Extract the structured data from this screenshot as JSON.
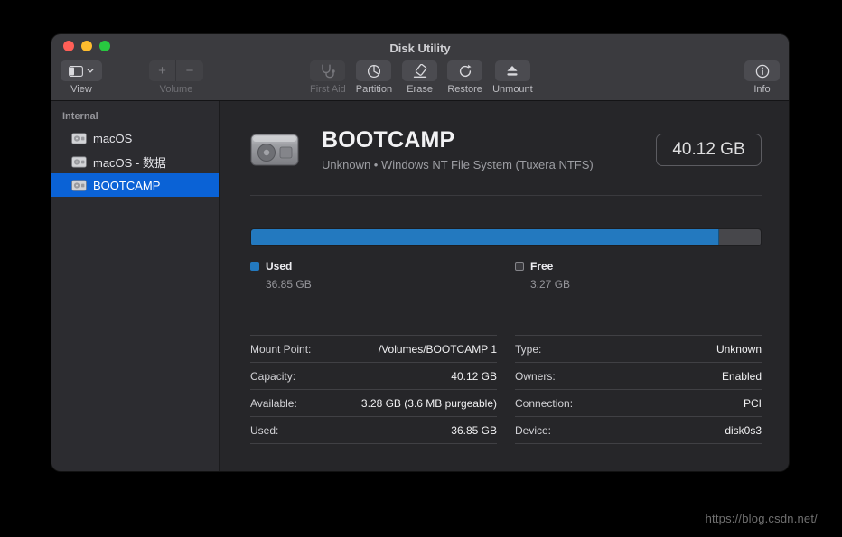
{
  "window": {
    "title": "Disk Utility"
  },
  "toolbar": {
    "view_label": "View",
    "volume_label": "Volume",
    "volume_add_label": "+",
    "volume_remove_label": "−",
    "buttons": [
      {
        "id": "first-aid",
        "label": "First Aid",
        "icon": "first-aid-icon",
        "enabled": false
      },
      {
        "id": "partition",
        "label": "Partition",
        "icon": "partition-icon",
        "enabled": true
      },
      {
        "id": "erase",
        "label": "Erase",
        "icon": "erase-icon",
        "enabled": true
      },
      {
        "id": "restore",
        "label": "Restore",
        "icon": "restore-icon",
        "enabled": true
      },
      {
        "id": "unmount",
        "label": "Unmount",
        "icon": "unmount-icon",
        "enabled": true
      }
    ],
    "info_label": "Info"
  },
  "sidebar": {
    "section": "Internal",
    "items": [
      {
        "label": "macOS",
        "selected": false
      },
      {
        "label": "macOS - 数据",
        "selected": false
      },
      {
        "label": "BOOTCAMP",
        "selected": true
      }
    ]
  },
  "main": {
    "volume_name": "BOOTCAMP",
    "volume_subtitle": "Unknown • Windows NT File System (Tuxera NTFS)",
    "capacity_badge": "40.12 GB",
    "usage": {
      "used_label": "Used",
      "used_value": "36.85 GB",
      "free_label": "Free",
      "free_value": "3.27 GB",
      "used_percent": 91.8
    },
    "details_left": [
      {
        "label": "Mount Point:",
        "value": "/Volumes/BOOTCAMP 1"
      },
      {
        "label": "Capacity:",
        "value": "40.12 GB"
      },
      {
        "label": "Available:",
        "value": "3.28 GB (3.6 MB purgeable)"
      },
      {
        "label": "Used:",
        "value": "36.85 GB"
      }
    ],
    "details_right": [
      {
        "label": "Type:",
        "value": "Unknown"
      },
      {
        "label": "Owners:",
        "value": "Enabled"
      },
      {
        "label": "Connection:",
        "value": "PCI"
      },
      {
        "label": "Device:",
        "value": "disk0s3"
      }
    ]
  },
  "watermark": "https://blog.csdn.net/",
  "colors": {
    "accent": "#0a62d6",
    "bar_used": "#2379bf",
    "bar_free": "#47474b",
    "traffic_red": "#ff5f57",
    "traffic_yellow": "#febc2e",
    "traffic_green": "#28c840"
  }
}
